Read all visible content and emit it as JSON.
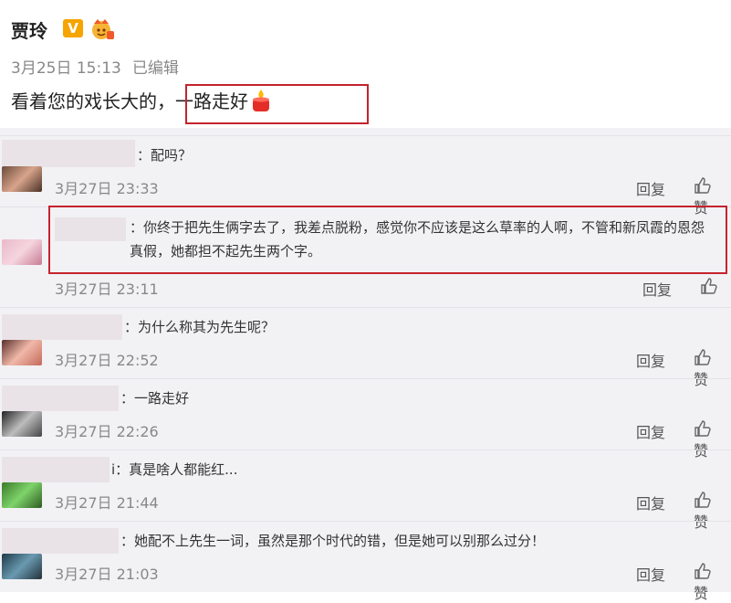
{
  "post": {
    "author": "贾玲",
    "v_badge": "V",
    "date": "3月25日 15:13",
    "edited": "已编辑",
    "text_before": "看着您的戏长大的",
    "text_highlight": "，一路走好"
  },
  "comments": [
    {
      "text": "：配吗？",
      "time": "3月27日 23:33",
      "reply": "回复",
      "like": "赞"
    },
    {
      "text": "：你终于把先生俩字去了，我差点脱粉，感觉你不应该是这么草率的人啊，不管和新凤霞的恩怨真假，她都担不起先生两个字。",
      "time": "3月27日 23:11",
      "reply": "回复",
      "like": ""
    },
    {
      "text": "：为什么称其为先生呢？",
      "time": "3月27日 22:52",
      "reply": "回复",
      "like": "赞"
    },
    {
      "text": "：一路走好",
      "time": "3月27日 22:26",
      "reply": "回复",
      "like": "赞"
    },
    {
      "text": "i：真是啥人都能红...",
      "time": "3月27日 21:44",
      "reply": "回复",
      "like": "赞"
    },
    {
      "text": "：她配不上先生一词，虽然是那个时代的错，但是她可以别那么过分！",
      "time": "3月27日 21:03",
      "reply": "回复",
      "like": "赞"
    }
  ],
  "colors": {
    "highlight_border": "#c4232d",
    "badge": "#f5a400"
  }
}
